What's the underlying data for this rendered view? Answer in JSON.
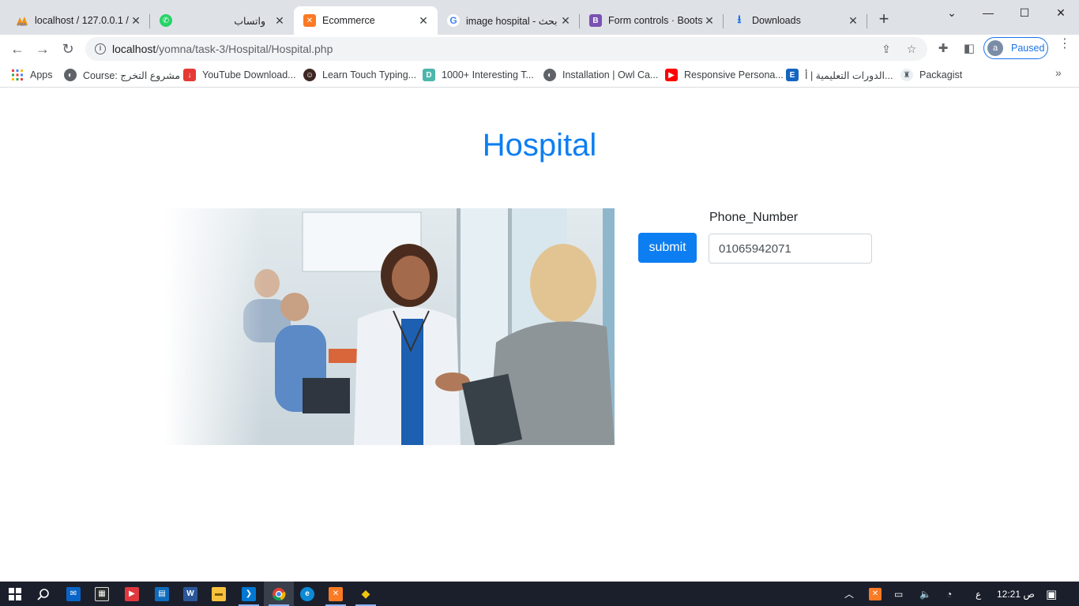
{
  "browser": {
    "tabs": [
      {
        "title": "localhost / 127.0.0.1 / ",
        "icon": "phpmyadmin-icon",
        "active": false
      },
      {
        "title": "واتساب",
        "icon": "whatsapp-icon",
        "active": false
      },
      {
        "title": "Ecommerce",
        "icon": "xampp-icon",
        "active": true
      },
      {
        "title": "image hospital - بحث",
        "icon": "google-icon",
        "active": false
      },
      {
        "title": "Form controls · Bootst",
        "icon": "bootstrap-icon",
        "active": false
      },
      {
        "title": "Downloads",
        "icon": "download-icon",
        "active": false
      }
    ],
    "url_host": "localhost",
    "url_path": "/yomna/task-3/Hospital/Hospital.php",
    "profile_initial": "a",
    "profile_status": "Paused"
  },
  "bookmarks": [
    {
      "label": "Apps"
    },
    {
      "label": "Course: مشروع التخرج"
    },
    {
      "label": "YouTube Download..."
    },
    {
      "label": "Learn Touch Typing..."
    },
    {
      "label": "1000+ Interesting T..."
    },
    {
      "label": "Installation | Owl Ca..."
    },
    {
      "label": "Responsive Persona..."
    },
    {
      "label": "الدورات التعليمية | أ..."
    },
    {
      "label": "Packagist"
    }
  ],
  "page": {
    "title": "Hospital",
    "form": {
      "label": "Phone_Number",
      "value": "01065942071",
      "submit_label": "submit"
    }
  },
  "taskbar": {
    "time": "12:21 ص",
    "lang": "ع"
  },
  "colors": {
    "accent": "#0d7ef2",
    "tabstrip": "#dee1e6",
    "taskbar": "#1b1f2b"
  }
}
